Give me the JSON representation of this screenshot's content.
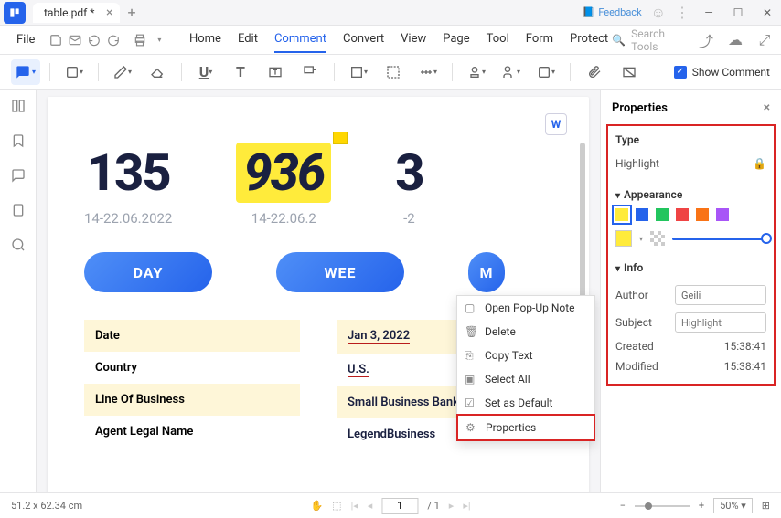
{
  "titlebar": {
    "tab_title": "table.pdf *",
    "feedback": "Feedback"
  },
  "menubar": {
    "file": "File",
    "items": [
      "Home",
      "Edit",
      "Comment",
      "Convert",
      "View",
      "Page",
      "Tool",
      "Form",
      "Protect"
    ],
    "active_index": 2,
    "search_placeholder": "Search Tools"
  },
  "toolbar": {
    "show_comment": "Show Comment"
  },
  "document": {
    "stats": [
      {
        "value": "135",
        "date": "14-22.06.2022",
        "highlighted": false
      },
      {
        "value": "936",
        "date": "14-22.06.2",
        "highlighted": true
      },
      {
        "value": "3",
        "date": "-2",
        "highlighted": false
      }
    ],
    "pills": [
      "DAY",
      "WEE",
      "M"
    ],
    "table_left": [
      {
        "label": "Date",
        "hl": true
      },
      {
        "label": "Country",
        "hl": false
      },
      {
        "label": "Line Of Business",
        "hl": true
      },
      {
        "label": "Agent Legal Name",
        "hl": false
      }
    ],
    "table_right": [
      {
        "label": "Jan 3, 2022",
        "hl": true,
        "underline": "red"
      },
      {
        "label": "U.S.",
        "hl": false,
        "underline": "thin-red"
      },
      {
        "label": "Small Business Banking",
        "hl": true
      },
      {
        "label": "LegendBusiness",
        "hl": false
      }
    ]
  },
  "context_menu": {
    "items": [
      "Open Pop-Up Note",
      "Delete",
      "Copy Text",
      "Select All",
      "Set as Default",
      "Properties"
    ],
    "highlighted_index": 5
  },
  "properties": {
    "title": "Properties",
    "type_label": "Type",
    "type_value": "Highlight",
    "appearance_label": "Appearance",
    "colors": [
      "#ffeb3b",
      "#2563eb",
      "#22c55e",
      "#ef4444",
      "#f97316",
      "#a855f7"
    ],
    "selected_color_index": 0,
    "info_label": "Info",
    "author_label": "Author",
    "author_value": "Geili",
    "subject_label": "Subject",
    "subject_value": "Highlight",
    "created_label": "Created",
    "created_value": "15:38:41",
    "modified_label": "Modified",
    "modified_value": "15:38:41"
  },
  "statusbar": {
    "dimensions": "51.2 x 62.34 cm",
    "page_current": "1",
    "page_total": "/ 1",
    "zoom": "50%"
  }
}
